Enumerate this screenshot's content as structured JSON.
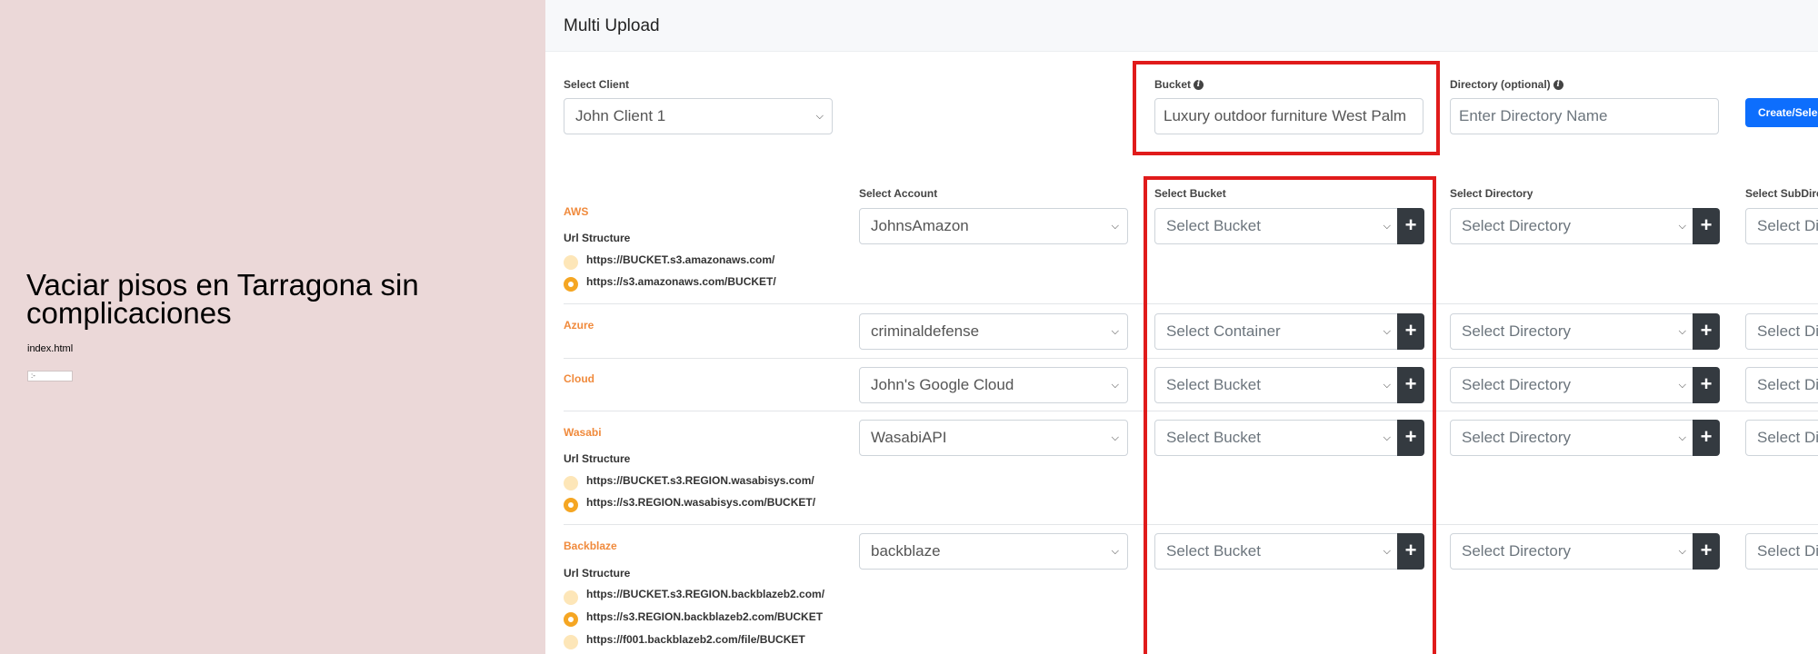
{
  "left": {
    "heading": "Vaciar pisos en Tarragona sin complicaciones",
    "filename": "index.html",
    "mini_input": ":-"
  },
  "header": {
    "title": "Multi Upload"
  },
  "top": {
    "client_label": "Select Client",
    "client_value": "John Client 1",
    "bucket_label": "Bucket",
    "bucket_value": "Luxury outdoor furniture West Palm",
    "directory_label": "Directory (optional)",
    "directory_placeholder": "Enter Directory Name",
    "create_button": "Create/Select"
  },
  "columns": {
    "account": "Select Account",
    "bucket": "Select Bucket",
    "directory": "Select Directory",
    "subdirectory": "Select SubDirectory"
  },
  "url_structure_label": "Url Structure",
  "providers": [
    {
      "name": "AWS",
      "account": "JohnsAmazon",
      "bucket": "Select Bucket",
      "directory": "Select Directory",
      "subdirectory": "Select Directory",
      "urls": [
        {
          "text": "https://BUCKET.s3.amazonaws.com/",
          "selected": false
        },
        {
          "text": "https://s3.amazonaws.com/BUCKET/",
          "selected": true
        }
      ]
    },
    {
      "name": "Azure",
      "account": "criminaldefense",
      "bucket": "Select Container",
      "directory": "Select Directory",
      "subdirectory": "Select Directory",
      "urls": []
    },
    {
      "name": "Cloud",
      "account": "John's Google Cloud",
      "bucket": "Select Bucket",
      "directory": "Select Directory",
      "subdirectory": "Select Directory",
      "urls": []
    },
    {
      "name": "Wasabi",
      "account": "WasabiAPI",
      "bucket": "Select Bucket",
      "directory": "Select Directory",
      "subdirectory": "Select Directory",
      "urls": [
        {
          "text": "https://BUCKET.s3.REGION.wasabisys.com/",
          "selected": false
        },
        {
          "text": "https://s3.REGION.wasabisys.com/BUCKET/",
          "selected": true
        }
      ]
    },
    {
      "name": "Backblaze",
      "account": "backblaze",
      "bucket": "Select Bucket",
      "directory": "Select Directory",
      "subdirectory": "Select Directory",
      "urls": [
        {
          "text": "https://BUCKET.s3.REGION.backblazeb2.com/",
          "selected": false
        },
        {
          "text": "https://s3.REGION.backblazeb2.com/BUCKET",
          "selected": true
        },
        {
          "text": "https://f001.backblazeb2.com/file/BUCKET",
          "selected": false
        }
      ]
    }
  ],
  "highlight_color": "#e01b1b",
  "accent_color": "#0d6efd",
  "provider_color": "#f08a3c"
}
